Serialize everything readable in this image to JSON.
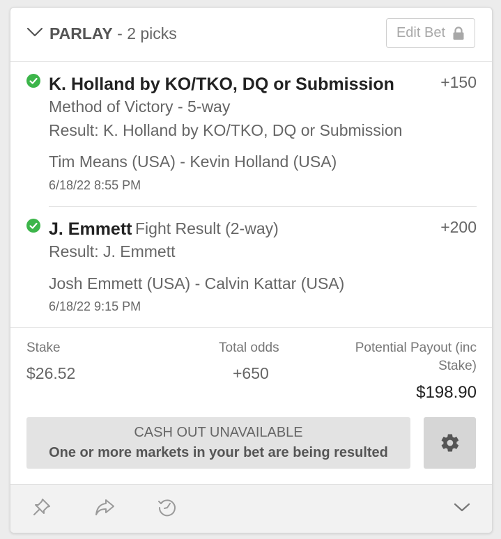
{
  "header": {
    "title_strong": "PARLAY",
    "title_rest": " - 2 picks",
    "edit_label": "Edit Bet"
  },
  "picks": [
    {
      "selection": "K. Holland by KO/TKO, DQ or Submission",
      "odds": "+150",
      "market": "Method of Victory - 5-way",
      "result": "Result: K. Holland by KO/TKO, DQ or Submission",
      "event": "Tim Means (USA) - Kevin Holland (USA)",
      "datetime": "6/18/22 8:55 PM",
      "status": "won"
    },
    {
      "selection": "J. Emmett",
      "odds": "+200",
      "market": "Fight Result (2-way)",
      "result": "Result: J. Emmett",
      "event": "Josh Emmett (USA) - Calvin Kattar (USA)",
      "datetime": "6/18/22 9:15 PM",
      "status": "won"
    }
  ],
  "summary": {
    "stake_label": "Stake",
    "stake_value": "$26.52",
    "odds_label": "Total odds",
    "odds_value": "+650",
    "payout_label_line1": "Potential Payout (inc",
    "payout_label_line2": "Stake)",
    "payout_value": "$198.90"
  },
  "cashout": {
    "title": "CASH OUT UNAVAILABLE",
    "message": "One or more markets in your bet are being resulted"
  },
  "icons": {
    "collapse": "chevron-down-icon",
    "lock": "lock-icon",
    "check": "check-circle-icon",
    "settings": "gear-icon",
    "pin": "pin-icon",
    "share": "share-icon",
    "history": "history-icon",
    "expand": "chevron-down-icon"
  },
  "colors": {
    "won_green": "#3cb54a",
    "card_bg": "#ffffff",
    "footer_bg": "#f2f2f2",
    "cashout_bg": "#e3e3e3"
  }
}
